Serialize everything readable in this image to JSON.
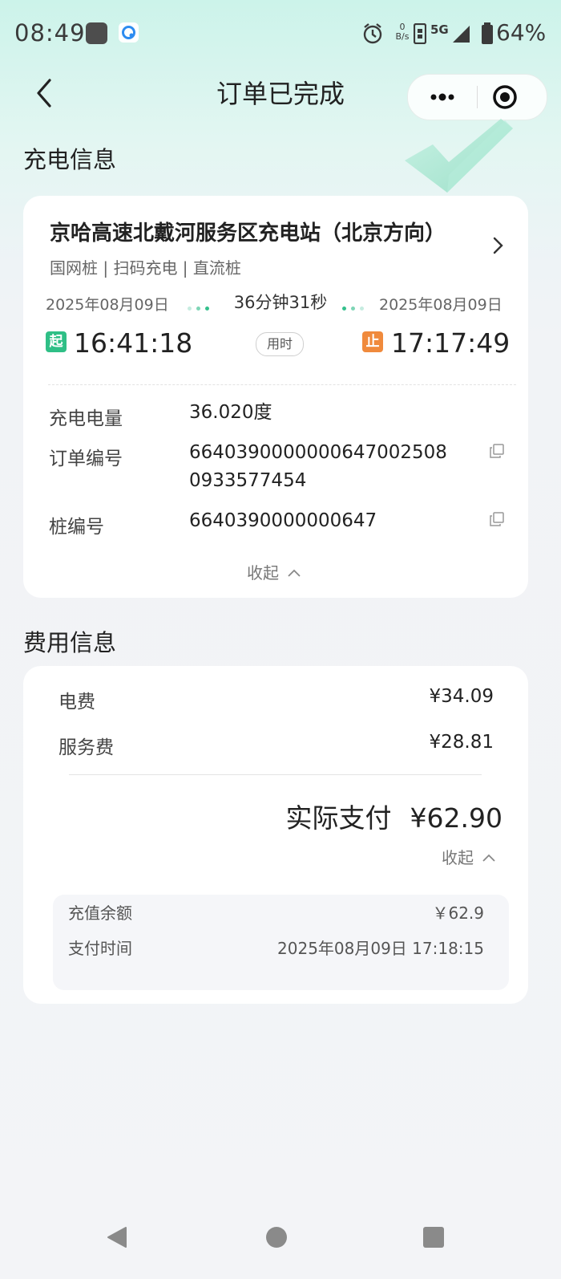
{
  "status_bar": {
    "time": "08:49",
    "net_speed_value": "0",
    "net_speed_unit": "B/s",
    "network": "5G",
    "battery": "64%"
  },
  "nav": {
    "title": "订单已完成"
  },
  "charging_section": {
    "title": "充电信息",
    "station_name": "京哈高速北戴河服务区充电站（北京方向）",
    "tags": "国网桩 | 扫码充电 | 直流桩",
    "start_date": "2025年08月09日",
    "end_date": "2025年08月09日",
    "duration": "36分钟31秒",
    "start_badge": "起",
    "end_badge": "止",
    "start_time": "16:41:18",
    "end_time": "17:17:49",
    "used_time_label": "用时",
    "rows": [
      {
        "label": "充电电量",
        "value": "36.020度"
      },
      {
        "label": "订单编号",
        "value_line1": "664039000000064700250 8",
        "value_line2": "0933577454"
      },
      {
        "label": "桩编号",
        "value": "6640390000000647"
      }
    ],
    "collapse_label": "收起"
  },
  "fee_section": {
    "title": "费用信息",
    "electricity_label": "电费",
    "electricity_value": "¥34.09",
    "service_label": "服务费",
    "service_value": "¥28.81",
    "actual_pay_label": "实际支付",
    "actual_pay_value": "¥62.90",
    "collapse_label": "收起",
    "balance_label": "充值余额",
    "balance_value": "￥62.9",
    "pay_time_label": "支付时间",
    "pay_time_value": "2025年08月09日 17:18:15"
  },
  "colors": {
    "accent_green": "#34c08c",
    "start_badge": "#2fbf86",
    "end_badge": "#f08a3c"
  },
  "icons": [
    "back-arrow-icon",
    "more-icon",
    "close-target-icon",
    "chevron-right-icon",
    "copy-icon",
    "chevron-up-icon",
    "nav-back-icon",
    "nav-home-icon",
    "nav-recent-icon"
  ]
}
